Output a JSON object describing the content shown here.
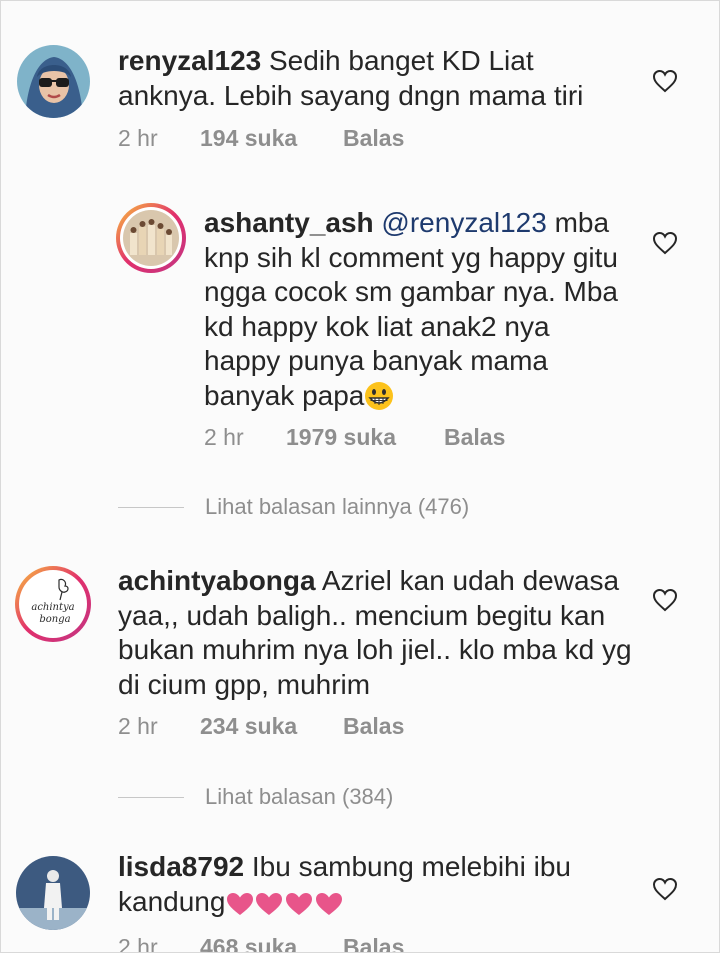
{
  "comments": [
    {
      "username": "renyzal123",
      "text": " Sedih banget KD Liat anknya.  Lebih sayang dngn mama tiri",
      "time": "2 hr",
      "likes": "194 suka",
      "reply": "Balas",
      "avatar": "woman-hijab-sunglasses"
    },
    {
      "username": "ashanty_ash",
      "mention": "@renyzal123",
      "text": " mba knp sih kl comment yg happy gitu ngga cocok sm gambar nya. Mba kd happy kok liat anak2 nya happy punya banyak mama banyak papa",
      "emoji": "grinning-face-emoji",
      "time": "2 hr",
      "likes": "1979 suka",
      "reply": "Balas",
      "avatar": "family-photo"
    },
    {
      "username": "achintyabonga",
      "text": " Azriel kan udah dewasa yaa,, udah baligh.. mencium begitu kan bukan muhrim nya loh jiel.. klo mba kd yg di cium gpp, muhrim",
      "time": "2 hr",
      "likes": "234 suka",
      "reply": "Balas",
      "avatar": "achintya-bonga-logo",
      "avatar_text": "achintya bonga"
    },
    {
      "username": "lisda8792",
      "text": " Ibu sambung melebihi ibu kandung",
      "emoji": "pink-hearts",
      "time": "2 hr",
      "likes": "468 suka",
      "reply": "Balas",
      "avatar": "person-standing"
    }
  ],
  "view_more": [
    {
      "label": "Lihat balasan lainnya (476)"
    },
    {
      "label": "Lihat balasan (384)"
    }
  ],
  "icons": {
    "like": "heart-outline-icon"
  },
  "colors": {
    "text": "#262626",
    "muted": "#8e8e8e",
    "mention": "#1e3a6e",
    "heart_emoji": "#e8558a"
  }
}
